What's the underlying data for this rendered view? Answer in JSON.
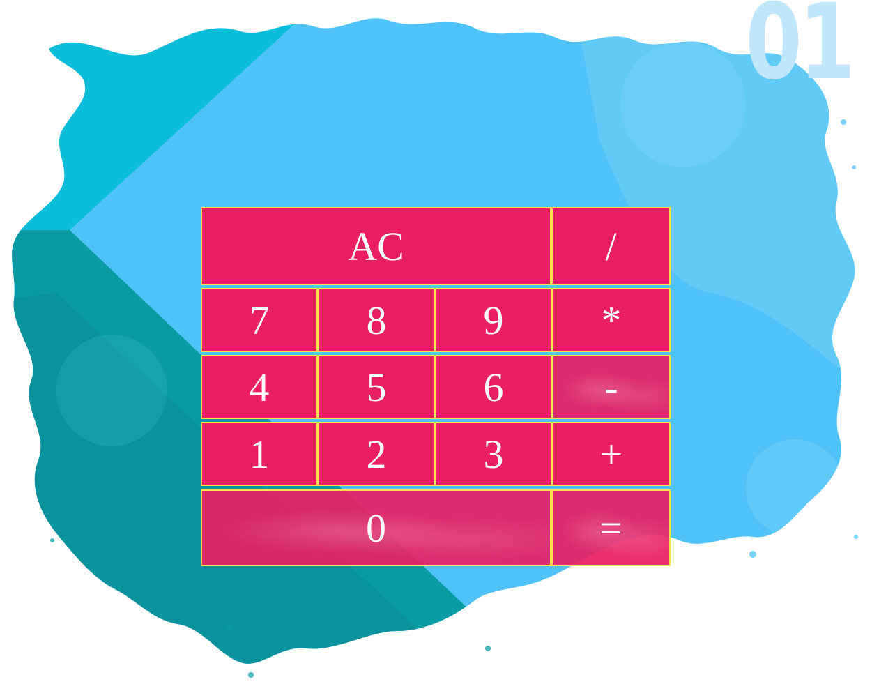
{
  "decor": {
    "corner_number": "01"
  },
  "calculator": {
    "keys": {
      "clear": "AC",
      "divide": "/",
      "seven": "7",
      "eight": "8",
      "nine": "9",
      "multiply": "*",
      "four": "4",
      "five": "5",
      "six": "6",
      "subtract": "-",
      "one": "1",
      "two": "2",
      "three": "3",
      "add": "+",
      "zero": "0",
      "equals": "="
    }
  },
  "colors": {
    "key_background": "#e91e63",
    "key_border": "#f7e14d",
    "key_text": "#ffffff",
    "splash_blue": "#4fc3f7",
    "splash_teal": "#0aa0a8",
    "splash_cyan": "#00bcd4"
  }
}
